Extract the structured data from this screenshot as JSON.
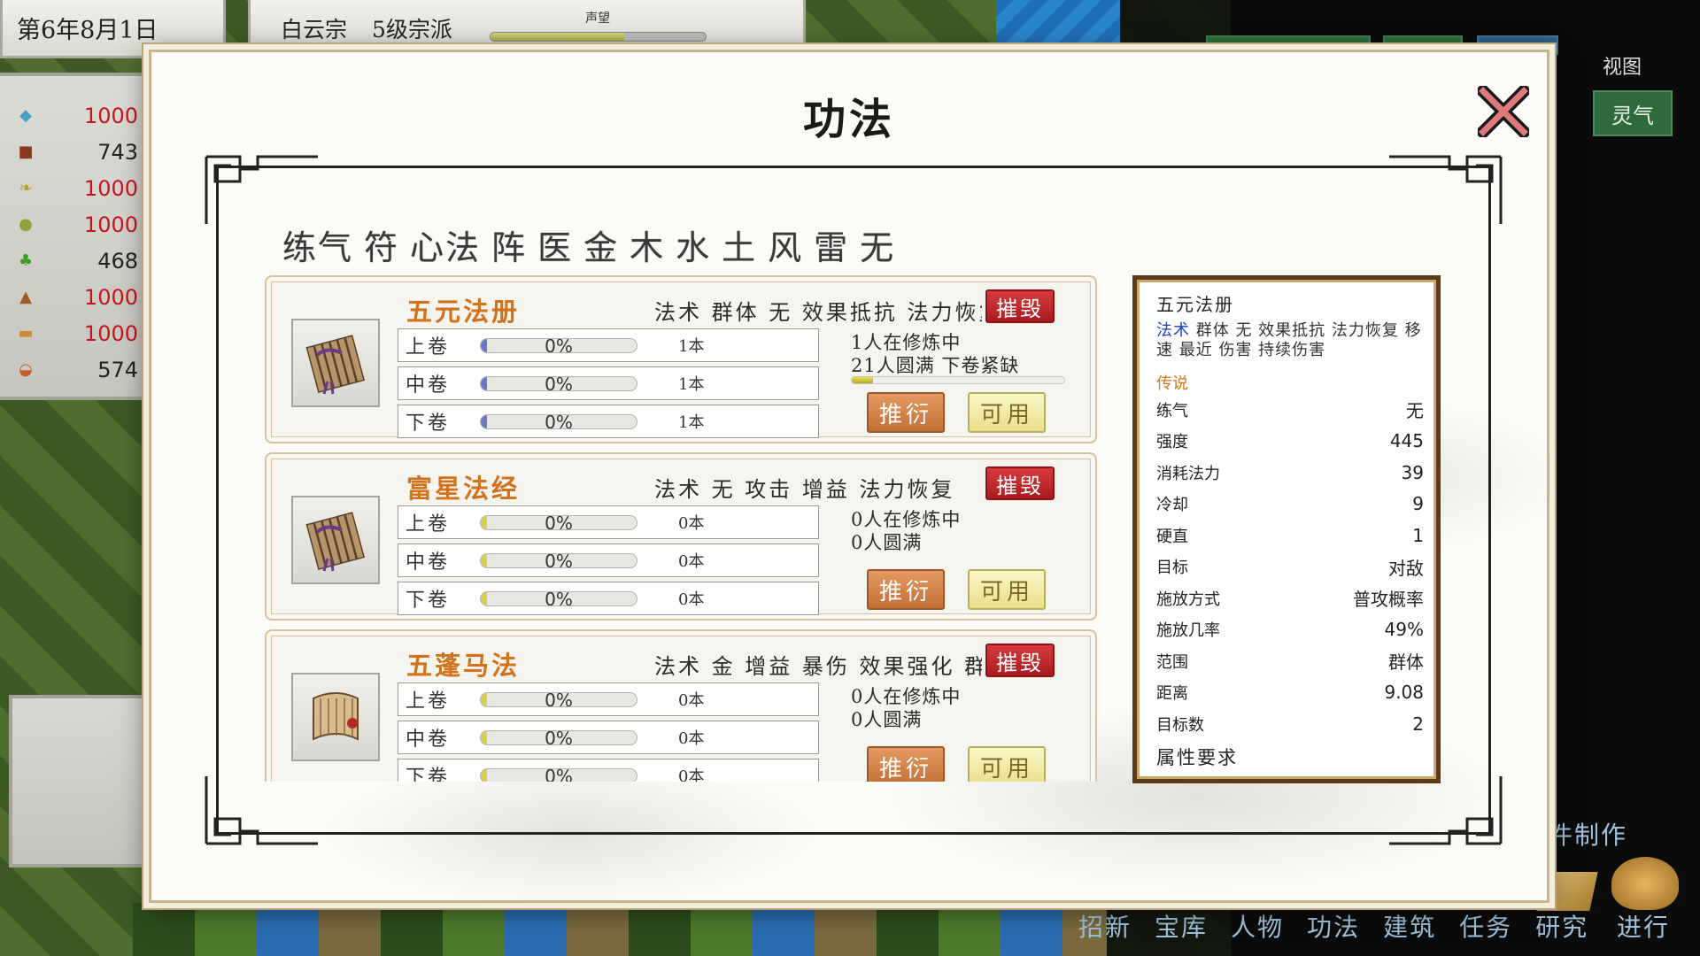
{
  "hud": {
    "date": "第6年8月1日",
    "sect_name": "白云宗",
    "sect_level": "5级宗派",
    "reputation_label": "声望",
    "reputation_fill": 0.62,
    "view_label": "视图",
    "lingqi_button": "灵气"
  },
  "resources": [
    {
      "icon": "spirit-stone-icon",
      "value": "1000",
      "color": "red"
    },
    {
      "icon": "treasure-chest-icon",
      "value": "743",
      "color": "dark"
    },
    {
      "icon": "herb-leaf-icon",
      "value": "1000",
      "color": "red"
    },
    {
      "icon": "jade-icon",
      "value": "1000",
      "color": "red"
    },
    {
      "icon": "gourd-icon",
      "value": "468",
      "color": "dark"
    },
    {
      "icon": "beast-hide-icon",
      "value": "1000",
      "color": "red"
    },
    {
      "icon": "wood-log-icon",
      "value": "1000",
      "color": "red"
    },
    {
      "icon": "food-bowl-icon",
      "value": "574",
      "color": "dark"
    }
  ],
  "bottom_nav": [
    "招新",
    "宝库",
    "人物",
    "功法",
    "建筑",
    "任务",
    "研究"
  ],
  "craft_label": "件制作",
  "go_button": "进行",
  "modal": {
    "title": "功法",
    "categories": [
      "练气",
      "符",
      "心法",
      "阵",
      "医",
      "金",
      "木",
      "水",
      "土",
      "风",
      "雷",
      "无"
    ],
    "cards": [
      {
        "name": "五元法册",
        "tags": "法术 群体 无 效果抵抗 法力恢复",
        "destroy": "摧毁",
        "volumes": [
          {
            "label": "上卷",
            "pct": "0%",
            "count": "1本"
          },
          {
            "label": "中卷",
            "pct": "0%",
            "count": "1本"
          },
          {
            "label": "下卷",
            "pct": "0%",
            "count": "1本"
          }
        ],
        "bar_color": "#6b79c9",
        "status1": "1人在修炼中",
        "status2": "21人圆满 下卷紧缺",
        "has_progress": true,
        "progress": 0.1,
        "deduce": "推衍",
        "usable": "可用"
      },
      {
        "name": "富星法经",
        "tags": "法术 无 攻击 增益 法力恢复",
        "destroy": "摧毁",
        "volumes": [
          {
            "label": "上卷",
            "pct": "0%",
            "count": "0本"
          },
          {
            "label": "中卷",
            "pct": "0%",
            "count": "0本"
          },
          {
            "label": "下卷",
            "pct": "0%",
            "count": "0本"
          }
        ],
        "bar_color": "#d8cc52",
        "status1": "0人在修炼中",
        "status2": "0人圆满",
        "has_progress": false,
        "progress": 0,
        "deduce": "推衍",
        "usable": "可用"
      },
      {
        "name": "五蓬马法",
        "tags": "法术 金 增益 暴伤 效果强化 群体",
        "destroy": "摧毁",
        "volumes": [
          {
            "label": "上卷",
            "pct": "0%",
            "count": "0本"
          },
          {
            "label": "中卷",
            "pct": "0%",
            "count": "0本"
          },
          {
            "label": "下卷",
            "pct": "0%",
            "count": "0本"
          }
        ],
        "bar_color": "#d8cc52",
        "status1": "0人在修炼中",
        "status2": "0人圆满",
        "has_progress": false,
        "progress": 0,
        "deduce": "推衍",
        "usable": "可用"
      }
    ],
    "detail": {
      "title": "五元法册",
      "type_word": "法术",
      "desc": " 群体 无 效果抵抗 法力恢复 移速 最近 伤害 持续伤害",
      "rarity": "传说",
      "stats": [
        {
          "k": "练气",
          "v": "无"
        },
        {
          "k": "强度",
          "v": "445"
        },
        {
          "k": "消耗法力",
          "v": "39"
        },
        {
          "k": "冷却",
          "v": "9"
        },
        {
          "k": "硬直",
          "v": "1"
        },
        {
          "k": "目标",
          "v": "对敌"
        },
        {
          "k": "施放方式",
          "v": "普攻概率"
        },
        {
          "k": "施放几率",
          "v": "49%"
        },
        {
          "k": "范围",
          "v": "群体"
        },
        {
          "k": "距离",
          "v": "9.08"
        },
        {
          "k": "目标数",
          "v": "2"
        }
      ],
      "requirement": "属性要求"
    }
  }
}
